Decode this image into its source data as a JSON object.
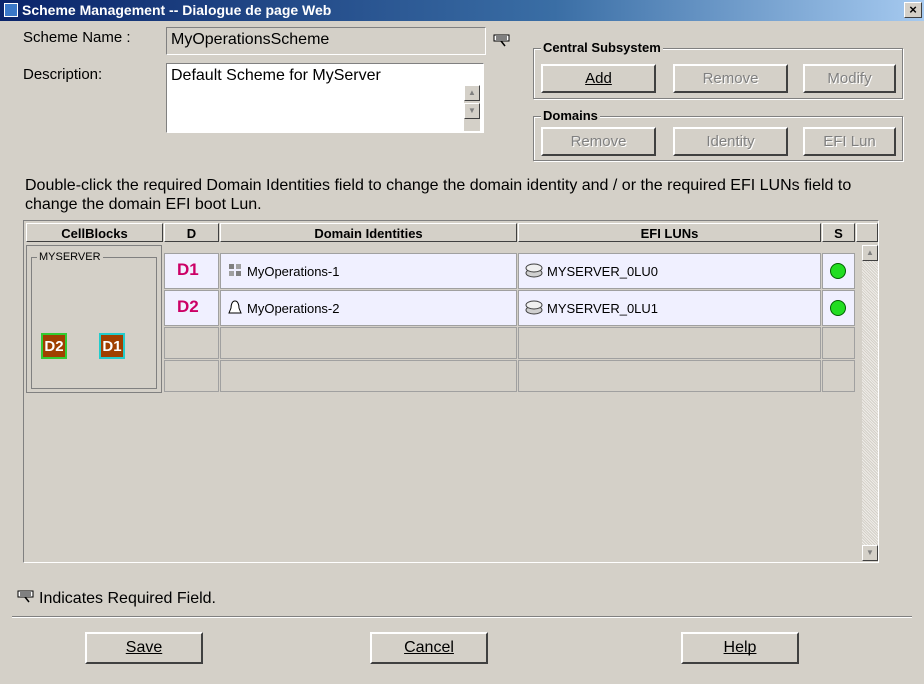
{
  "window": {
    "title": "Scheme Management -- Dialogue de page Web",
    "close_glyph": "×"
  },
  "form": {
    "scheme_name_label": "Scheme Name :",
    "scheme_name_value": "MyOperationsScheme",
    "description_label": "Description:",
    "description_value": "Default Scheme for MyServer"
  },
  "central_subsystem": {
    "title": "Central Subsystem",
    "add": "Add",
    "remove": "Remove",
    "modify": "Modify"
  },
  "domains": {
    "title": "Domains",
    "remove": "Remove",
    "identity": "Identity",
    "efi_lun": "EFI Lun"
  },
  "info_text": "Double-click the required Domain Identities field to change the domain identity and / or the required EFI LUNs field to change the domain EFI boot Lun.",
  "table": {
    "headers": {
      "cellblocks": "CellBlocks",
      "d": "D",
      "identities": "Domain Identities",
      "efi": "EFI LUNs",
      "s": "S"
    },
    "cellblock_group": "MYSERVER",
    "cellblock_badges": [
      "D2",
      "D1"
    ],
    "rows": [
      {
        "d": "D1",
        "identity": "MyOperations-1",
        "identity_icon": "windows-icon",
        "efi": "MYSERVER_0LU0",
        "status": "green"
      },
      {
        "d": "D2",
        "identity": "MyOperations-2",
        "identity_icon": "linux-icon",
        "efi": "MYSERVER_0LU1",
        "status": "green"
      }
    ]
  },
  "footer": {
    "required_note": "Indicates Required Field.",
    "save": "Save",
    "cancel": "Cancel",
    "help": "Help"
  },
  "colors": {
    "title_bar": "#0a246a",
    "status_ok": "#22dd22",
    "row_fill": "#f0f0ff"
  }
}
